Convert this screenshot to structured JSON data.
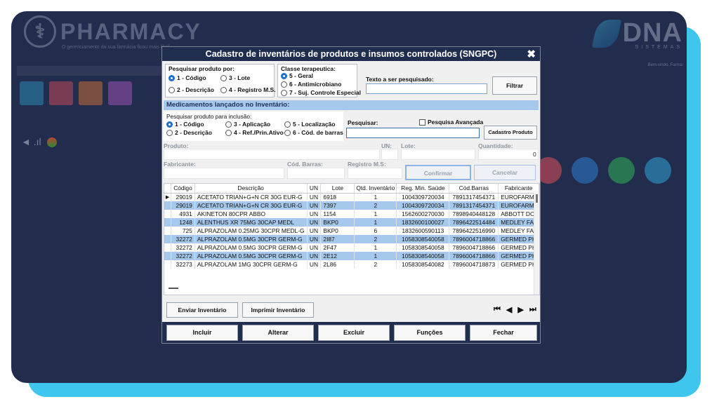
{
  "background": {
    "logo_name": "PHARMACY",
    "logo_tagline": "O gerenciamento da sua farmácia ficou mais fácil",
    "dna_name": "DNA",
    "dna_sub": "SISTEMAS",
    "dna_tag": "Bem-vindo, Farma"
  },
  "dialog": {
    "title": "Cadastro de inventários  de produtos  e insumos  controlados (SNGPC)",
    "close": "✖"
  },
  "search_by": {
    "label": "Pesquisar produto por:",
    "options": [
      "1 - Código",
      "3 - Lote",
      "2 - Descrição",
      "4 - Registro M.S."
    ]
  },
  "therapeutic_class": {
    "label": "Classe terapeutica:",
    "options": [
      "5 - Geral",
      "6 - Antimicrobiano",
      "7 - Suj. Controle Especial"
    ]
  },
  "search_text": {
    "label": "Texto a ser pesquisado:",
    "value": "",
    "filter_button": "Filtrar"
  },
  "section_title": "Medicamentos lançados no Inventário:",
  "inclusion_search": {
    "label": "Pesquisar produto para inclusão:",
    "options": [
      "1 - Código",
      "3 - Aplicação",
      "5 - Localização",
      "2 - Descrição",
      "4 - Ref./Prin.Ativo",
      "6 - Cód. de barras"
    ],
    "search_label": "Pesquisar:",
    "advanced_label": "Pesquisa Avançada",
    "register_button": "Cadastro Produto"
  },
  "fields": {
    "produto": "Produto:",
    "un": "UN:",
    "lote": "Lote:",
    "quantidade": "Quantidade:",
    "quantidade_value": "0",
    "fabricante": "Fabricante:",
    "cod_barras": "Cód. Barras:",
    "registro": "Registro M.S:",
    "confirm_button": "Confirmar",
    "cancel_button": "Cancelar"
  },
  "table": {
    "columns": [
      "Código",
      "Descrição",
      "UN",
      "Lote",
      "Qtd. Inventário",
      "Reg. Min. Saúde",
      "Cód.Barras",
      "Fabricante"
    ],
    "rows": [
      [
        "29019",
        "ACETATO TRIAN+G+N CR 30G EUR-G",
        "UN",
        "6918",
        "1",
        "1004309720034",
        "7891317454371",
        "EUROFARM"
      ],
      [
        "29019",
        "ACETATO TRIAN+G+N CR 30G EUR-G",
        "UN",
        "7397",
        "2",
        "1004309720034",
        "7891317454371",
        "EUROFARM"
      ],
      [
        "4931",
        "AKINETON 80CPR ABBO",
        "UN",
        "1154",
        "1",
        "1562600270030",
        "7898940448128",
        "ABBOTT DC"
      ],
      [
        "1248",
        "ALENTHUS XR 75MG 30CAP MEDL",
        "UN",
        "BKP0",
        "1",
        "1832600100027",
        "7896422514484",
        "MEDLEY FA"
      ],
      [
        "725",
        "ALPRAZOLAM 0.25MG 30CPR MEDL-G",
        "UN",
        "BKP0",
        "6",
        "1832600590113",
        "7896422516990",
        "MEDLEY FA"
      ],
      [
        "32272",
        "ALPRAZOLAM 0.5MG 30CPR GERM-G",
        "UN",
        "2I87",
        "2",
        "1058308540058",
        "7896004718866",
        "GERMED PH"
      ],
      [
        "32272",
        "ALPRAZOLAM 0.5MG 30CPR GERM-G",
        "UN",
        "2F47",
        "1",
        "1058308540058",
        "7896004718866",
        "GERMED PH"
      ],
      [
        "32272",
        "ALPRAZOLAM 0.5MG 30CPR GERM-G",
        "UN",
        "2E12",
        "1",
        "1058308540058",
        "7896004718866",
        "GERMED PH"
      ],
      [
        "32273",
        "ALPRAZOLAM 1MG 30CPR GERM-G",
        "UN",
        "2L86",
        "2",
        "1058308540082",
        "7896004718873",
        "GERMED PH"
      ]
    ],
    "highlighted_rows": [
      1,
      3,
      5,
      7
    ]
  },
  "actions": {
    "send": "Enviar Inventário",
    "print": "Imprimir Inventário",
    "nav": [
      "⏮",
      "◀",
      "▶",
      "⏭"
    ]
  },
  "bottom": {
    "incluir": "Incluir",
    "alterar": "Alterar",
    "excluir": "Excluir",
    "funcoes": "Funções",
    "fechar": "Fechar"
  },
  "colors": {
    "title_bar": "#1f2d4f",
    "highlight_row": "#a6c8ec",
    "frame_accent": "#3ec6ee"
  }
}
